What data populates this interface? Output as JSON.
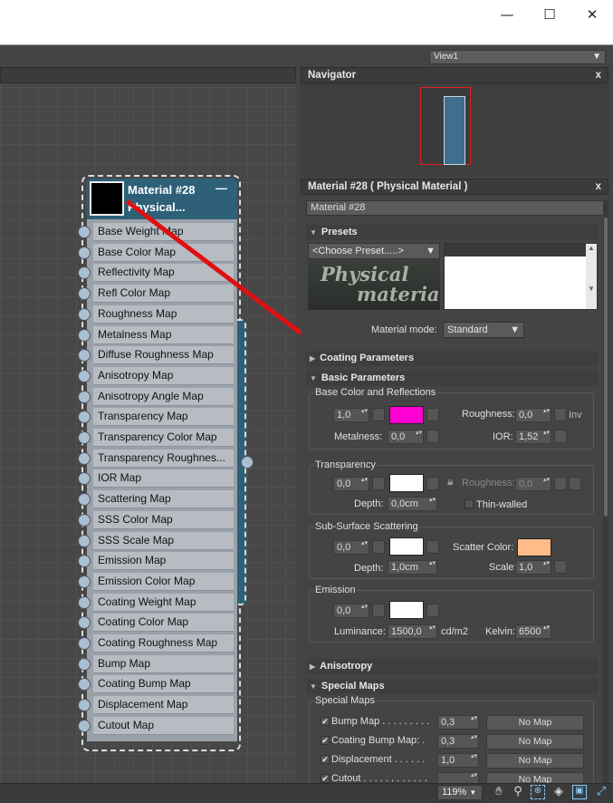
{
  "window": {
    "minimize": "—",
    "maximize": "☐",
    "close": "✕"
  },
  "toolbar": {
    "view_select": "View1",
    "view_arrow": "▼"
  },
  "navigator": {
    "title": "Navigator",
    "close": "x"
  },
  "node": {
    "title_line1": "Material #28",
    "title_line2": "Physical...",
    "collapse": "—",
    "slots": [
      "Base Weight Map",
      "Base Color Map",
      "Reflectivity Map",
      "Refl Color Map",
      "Roughness Map",
      "Metalness Map",
      "Diffuse Roughness Map",
      "Anisotropy Map",
      "Anisotropy Angle Map",
      "Transparency Map",
      "Transparency Color Map",
      "Transparency Roughnes...",
      "IOR Map",
      "Scattering Map",
      "SSS Color Map",
      "SSS Scale Map",
      "Emission Map",
      "Emission Color Map",
      "Coating Weight Map",
      "Coating Color Map",
      "Coating Roughness Map",
      "Bump Map",
      "Coating Bump Map",
      "Displacement Map",
      "Cutout Map"
    ]
  },
  "material_panel": {
    "title": "Material #28  ( Physical Material )",
    "close": "x",
    "name_field": "Material #28",
    "presets": {
      "header": "Presets",
      "choose": "<Choose Preset.....>",
      "logo_line1": "Physical",
      "logo_line2": "material",
      "mode_label": "Material mode:",
      "mode_value": "Standard"
    },
    "coating": {
      "header": "Coating Parameters"
    },
    "basic": {
      "header": "Basic Parameters",
      "group": "Base Color and Reflections",
      "weight": "1,0",
      "roughness_label": "Roughness:",
      "roughness": "0,0",
      "inv": "Inv",
      "metalness_label": "Metalness:",
      "metalness": "0,0",
      "ior_label": "IOR:",
      "ior": "1,52",
      "base_color": "#ff00d2"
    },
    "transparency": {
      "group": "Transparency",
      "weight": "0,0",
      "roughness_label": "Roughness:",
      "roughness": "0,0",
      "depth_label": "Depth:",
      "depth": "0,0cm",
      "thin": "Thin-walled"
    },
    "sss": {
      "group": "Sub-Surface Scattering",
      "weight": "0,0",
      "scatter_label": "Scatter Color:",
      "scatter_color": "#ffbb88",
      "depth_label": "Depth:",
      "depth": "1,0cm",
      "scale_label": "Scale:",
      "scale": "1,0"
    },
    "emission": {
      "group": "Emission",
      "weight": "0,0",
      "luminance_label": "Luminance:",
      "luminance": "1500,0",
      "unit": "cd/m2",
      "kelvin_label": "Kelvin:",
      "kelvin": "6500"
    },
    "anisotropy": {
      "header": "Anisotropy"
    },
    "special": {
      "header": "Special Maps",
      "group": "Special Maps",
      "rows": [
        {
          "label": "Bump Map . . . . . . . . .",
          "value": "0,3",
          "map": "No Map"
        },
        {
          "label": "Coating Bump Map: .",
          "value": "0,3",
          "map": "No Map"
        },
        {
          "label": "Displacement . . . . . .",
          "value": "1,0",
          "map": "No Map"
        },
        {
          "label": "Cutout . . . . . . . . . . . .",
          "value": "",
          "map": "No Map"
        }
      ]
    }
  },
  "status": {
    "zoom": "119%",
    "zoom_arrow": "▼"
  }
}
